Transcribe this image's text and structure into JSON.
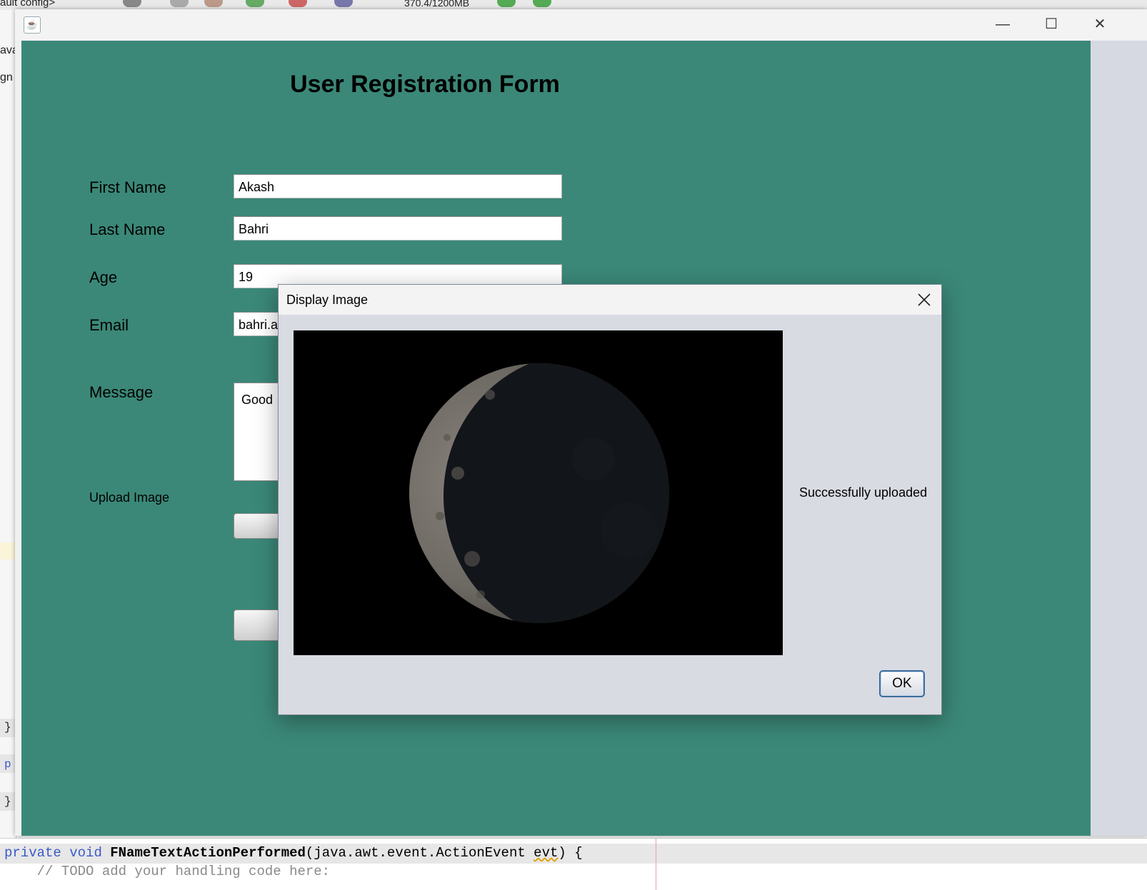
{
  "ide": {
    "config_label": "ault config>",
    "memory_label": "370.4/1200MB",
    "left_frags": [
      "ava",
      "gn",
      "}",
      "p",
      "}"
    ],
    "code_line1": {
      "kw1": "private",
      "kw2": "void",
      "fn": "FNameTextActionPerformed",
      "params_before": "(java.awt.event.ActionEvent ",
      "squig": "evt",
      "params_after": ") {"
    },
    "code_line2": "    // TODO add your handling code here:"
  },
  "window": {
    "icon": "java-icon",
    "controls": {
      "minimize": "—",
      "maximize": "☐",
      "close": "✕"
    }
  },
  "form": {
    "title": "User Registration Form",
    "background": "#3b8878",
    "fields": {
      "first_name": {
        "label": "First Name",
        "value": "Akash"
      },
      "last_name": {
        "label": "Last Name",
        "value": "Bahri"
      },
      "age": {
        "label": "Age",
        "value": "19"
      },
      "email": {
        "label": "Email",
        "value": "bahri.a"
      },
      "message": {
        "label": "Message",
        "value": "Good"
      }
    },
    "upload_label": "Upload Image"
  },
  "dialog": {
    "title": "Display Image",
    "status": "Successfully uploaded",
    "ok_label": "OK",
    "image": "crescent-moon"
  }
}
